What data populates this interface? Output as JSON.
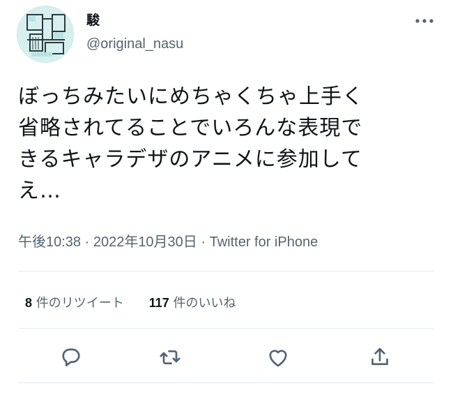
{
  "user": {
    "display_name": "駿",
    "handle": "@original_nasu",
    "avatar_icon": "geometric-avatar-icon"
  },
  "header": {
    "more_icon": "more-options-icon"
  },
  "tweet": {
    "lines": [
      "ぼっちみたいにめちゃくちゃ上手く",
      "省略されてることでいろんな表現で",
      "きるキャラデザのアニメに参加して",
      "え…"
    ],
    "meta": "午後10:38 · 2022年10月30日 · Twitter for iPhone"
  },
  "stats": {
    "retweets_count": "8",
    "retweets_label": " 件のリツイート",
    "likes_count": "117",
    "likes_label": " 件のいいね"
  },
  "actions": {
    "reply_icon": "reply-icon",
    "retweet_icon": "retweet-icon",
    "like_icon": "like-icon",
    "share_icon": "share-icon"
  },
  "colors": {
    "text": "#0f1419",
    "secondary": "#536471",
    "divider": "#e6ebee",
    "avatar_bg": "#d6f0ef"
  }
}
